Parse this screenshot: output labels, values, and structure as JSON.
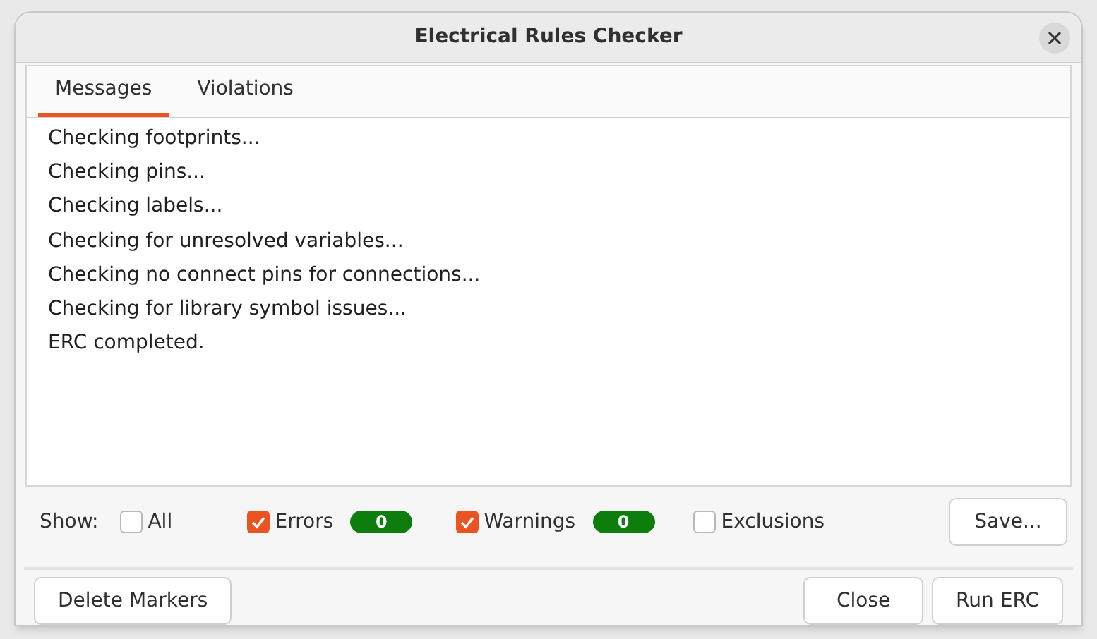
{
  "window": {
    "title": "Electrical Rules Checker"
  },
  "tabs": [
    {
      "label": "Messages",
      "selected": true
    },
    {
      "label": "Violations",
      "selected": false
    }
  ],
  "messages": [
    "Checking footprints...",
    "Checking pins...",
    "Checking labels...",
    "Checking for unresolved variables...",
    "Checking no connect pins for connections...",
    "Checking for library symbol issues...",
    "ERC completed."
  ],
  "filter": {
    "label": "Show:",
    "options": [
      {
        "label": "All",
        "checked": false
      },
      {
        "label": "Errors",
        "checked": true,
        "count": "0"
      },
      {
        "label": "Warnings",
        "checked": true,
        "count": "0"
      },
      {
        "label": "Exclusions",
        "checked": false
      }
    ]
  },
  "save_button": "Save...",
  "buttons": [
    {
      "label": "Delete Markers",
      "kind": "left"
    },
    {
      "label": "Close",
      "kind": "right"
    },
    {
      "label": "Run ERC",
      "kind": "right"
    }
  ]
}
